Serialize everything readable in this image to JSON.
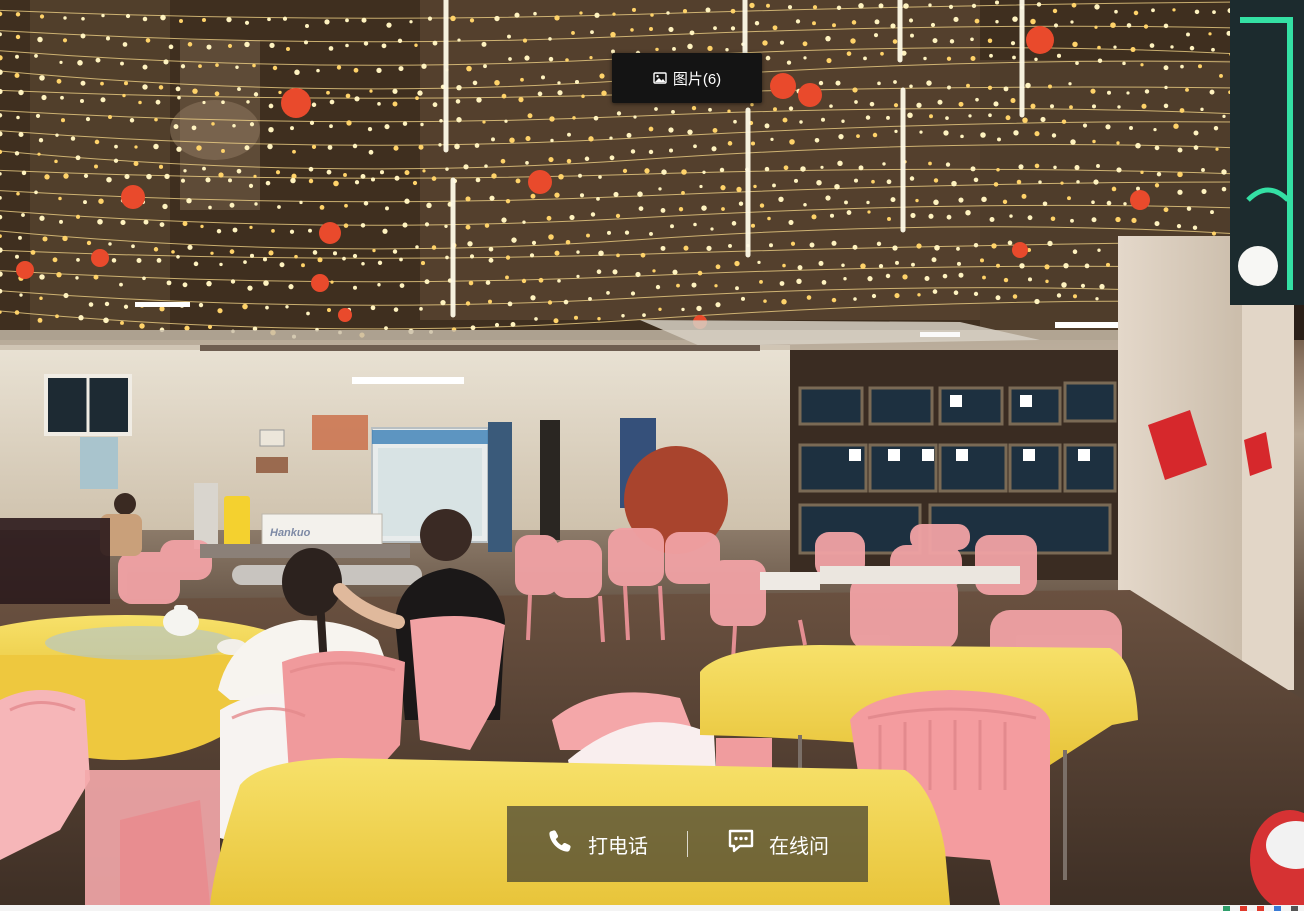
{
  "gallery": {
    "badge_label": "图片(6)",
    "badge_icon": "image-icon"
  },
  "photo": {
    "fridge_brand": "Hankuo"
  },
  "actions": {
    "call_label": "打电话",
    "call_icon": "phone-icon",
    "chat_label": "在线问",
    "chat_icon": "chat-icon"
  },
  "colors": {
    "badge_bg": "#141414",
    "action_bar_bg": "#44403079",
    "tablecloth": "#f2d54a",
    "chair": "#f2a5a8"
  }
}
